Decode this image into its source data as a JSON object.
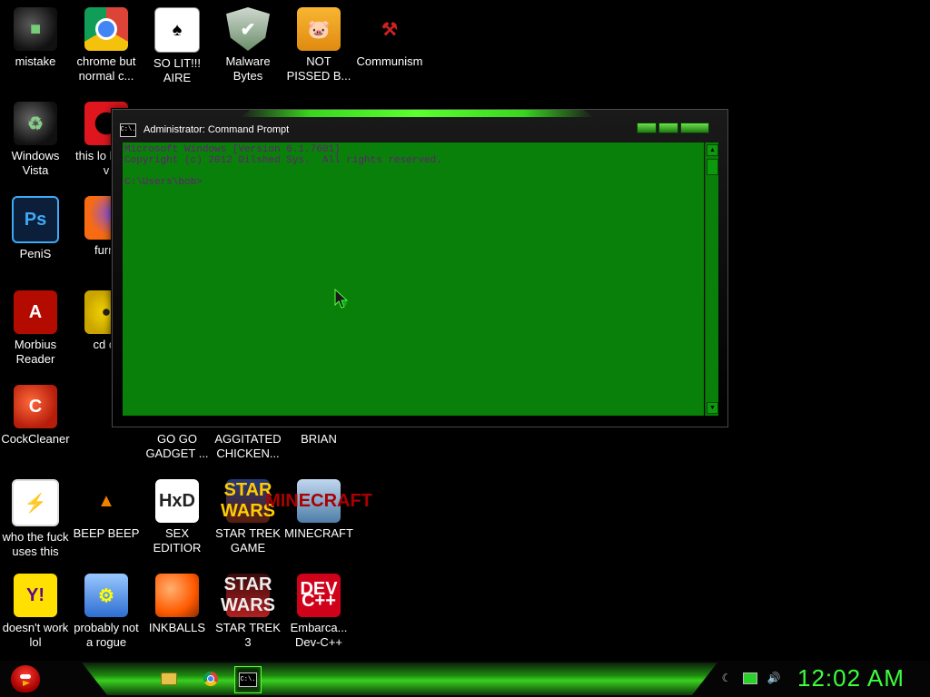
{
  "desktop": {
    "icons": [
      {
        "label": "mistake",
        "glyph": "■"
      },
      {
        "label": "chrome but normal c...",
        "glyph": ""
      },
      {
        "label": "SO LIT!!! AIRE",
        "glyph": "♠"
      },
      {
        "label": "Malware Bytes",
        "glyph": "✔"
      },
      {
        "label": "NOT PISSED B...",
        "glyph": "🐷"
      },
      {
        "label": "Communism",
        "glyph": "⚒"
      },
      {
        "label": "Windows Vista",
        "glyph": "♻"
      },
      {
        "label": "this lo like a v",
        "glyph": ""
      },
      {
        "label": "PeniS",
        "glyph": "Ps"
      },
      {
        "label": "furry",
        "glyph": ""
      },
      {
        "label": "Morbius Reader",
        "glyph": "A"
      },
      {
        "label": "cd dr",
        "glyph": ""
      },
      {
        "label": "CockCleaner",
        "glyph": "C"
      },
      {
        "label": "GO GO GADGET ...",
        "glyph": ""
      },
      {
        "label": "AGGITATED CHICKEN...",
        "glyph": ""
      },
      {
        "label": "BRIAN",
        "glyph": ""
      },
      {
        "label": "who the fuck uses this",
        "glyph": "⚡"
      },
      {
        "label": "BEEP BEEP",
        "glyph": "▲"
      },
      {
        "label": "SEX EDITIOR",
        "glyph": "HxD"
      },
      {
        "label": "STAR TREK GAME",
        "glyph": "STAR WARS"
      },
      {
        "label": "MINECRAFT",
        "glyph": "MINECRAFT"
      },
      {
        "label": "doesn't work lol",
        "glyph": "Y!"
      },
      {
        "label": "probably not a rogue",
        "glyph": "⚙"
      },
      {
        "label": "INKBALLS",
        "glyph": ""
      },
      {
        "label": "STAR TREK 3",
        "glyph": "STAR WARS"
      },
      {
        "label": "Embarca... Dev-C++",
        "glyph": "DEV\nC++"
      }
    ]
  },
  "cmd_window": {
    "title": "Administrator: Command Prompt",
    "title_icon_text": "C:\\.",
    "lines": [
      "Microsoft Windows [Version 6.1.7601]",
      "Copyright (c) 2012 Dilshed Sys.  All rights reserved.",
      "",
      "C:\\Users\\bob>"
    ],
    "console_bg": "#098009",
    "console_fg": "#6a1a7a"
  },
  "taskbar": {
    "clock": "12:02 AM",
    "accent": "#3cff3c",
    "cmd_icon_text": "C:\\."
  }
}
